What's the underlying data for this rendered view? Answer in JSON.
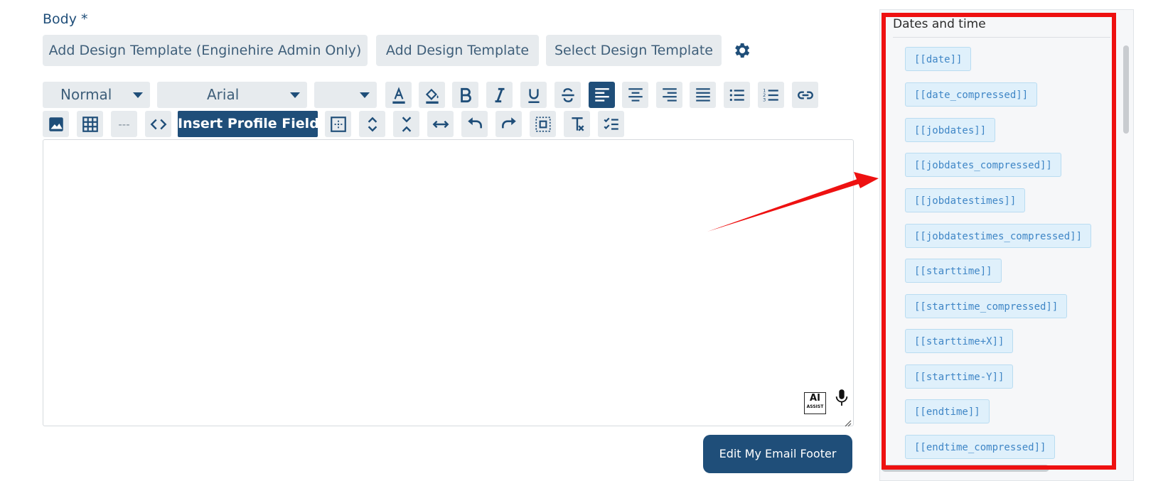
{
  "body_label": "Body *",
  "template_buttons": {
    "admin": "Add Design Template (Enginehire Admin Only)",
    "add": "Add Design Template",
    "select": "Select Design Template"
  },
  "toolbar": {
    "paragraph_style": "Normal",
    "font_family": "Arial",
    "font_size": "",
    "insert_profile_fields": "Insert Profile Fields",
    "hr_label": "---"
  },
  "ai_assist": {
    "main": "AI",
    "sub": "ASSIST"
  },
  "edit_footer_label": "Edit My Email Footer",
  "panel": {
    "title": "Dates and time",
    "tags": [
      "[[date]]",
      "[[date_compressed]]",
      "[[jobdates]]",
      "[[jobdates_compressed]]",
      "[[jobdatestimes]]",
      "[[jobdatestimes_compressed]]",
      "[[starttime]]",
      "[[starttime_compressed]]",
      "[[starttime+X]]",
      "[[starttime-Y]]",
      "[[endtime]]",
      "[[endtime_compressed]]"
    ]
  },
  "colors": {
    "brand": "#1f4e79",
    "button_bg": "#e7ebee",
    "tag_bg": "#dff0fb",
    "tag_text": "#3f86c6",
    "annotation": "#ee1111"
  },
  "icons": [
    "gear-icon",
    "font-color-icon",
    "highlight-icon",
    "bold-icon",
    "italic-icon",
    "underline-icon",
    "strikethrough-icon",
    "align-left-icon",
    "align-center-icon",
    "align-right-icon",
    "align-justify-icon",
    "bullet-list-icon",
    "numbered-list-icon",
    "link-icon",
    "image-icon",
    "table-icon",
    "code-view-icon",
    "select-all-icon",
    "line-height-icon",
    "collapse-icon",
    "width-icon",
    "undo-icon",
    "redo-icon",
    "frame-icon",
    "clear-format-icon",
    "checklist-icon",
    "microphone-icon"
  ]
}
